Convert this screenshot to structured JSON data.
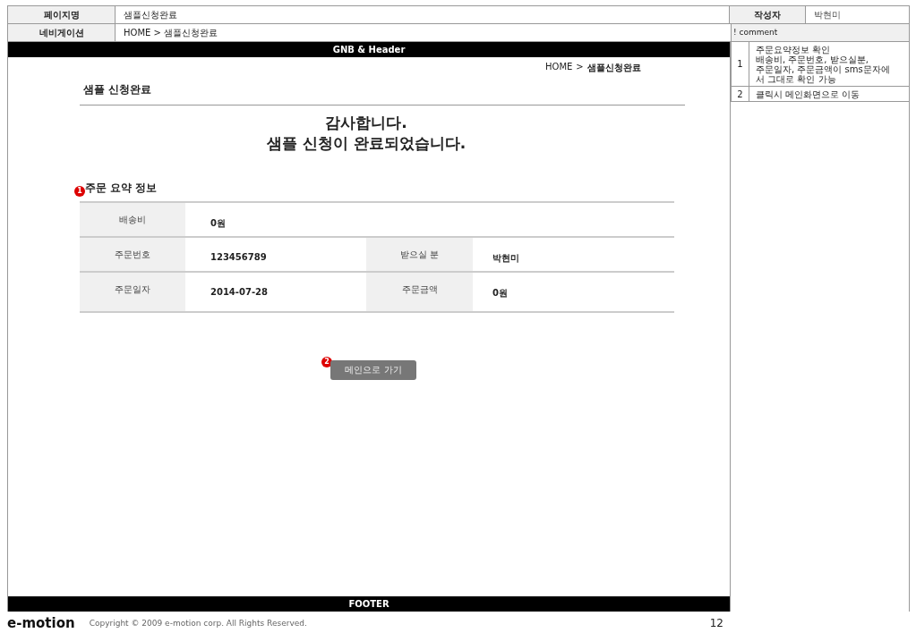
{
  "header": {
    "page_name_label": "페이지명",
    "page_name": "샘플신청완료",
    "author_label": "작성자",
    "author": "박현미",
    "nav_label": "네비게이션",
    "nav": "HOME > 샘플신청완료",
    "comment_label": "! comment"
  },
  "comments": [
    {
      "number": "1",
      "lines": [
        "주문요약정보 확인",
        "배송비, 주문번호, 받으실분,",
        "주문일자, 주문금액이 sms문자에",
        "서 그대로 확인 가능"
      ]
    },
    {
      "number": "2",
      "lines": [
        "클릭시 메인화면으로 이동"
      ]
    }
  ],
  "gnb": "GNB & Header",
  "breadcrumb": {
    "home": "HOME",
    "separator": ">",
    "current": "샘플신청완료"
  },
  "page_title": "샘플 신청완료",
  "thanks": [
    "감사합니다.",
    "샘플 신청이 완료되었습니다."
  ],
  "summary": {
    "badge": "1",
    "title": "주문 요약 정보",
    "rows": [
      [
        {
          "label": "배송비",
          "value": "0원"
        }
      ],
      [
        {
          "label": "주문번호",
          "value": "123456789"
        },
        {
          "label": "받으실 분",
          "value": "박현미"
        }
      ],
      [
        {
          "label": "주문일자",
          "value": "2014-07-28"
        },
        {
          "label": "주문금액",
          "value": "0원"
        }
      ]
    ]
  },
  "main_button": {
    "badge": "2",
    "label": "메인으로 가기"
  },
  "footer_bar": "FOOTER",
  "footer": {
    "logo": "e-motion",
    "copyright": "Copyright © 2009 e-motion corp. All Rights Reserved.",
    "page": "12"
  }
}
